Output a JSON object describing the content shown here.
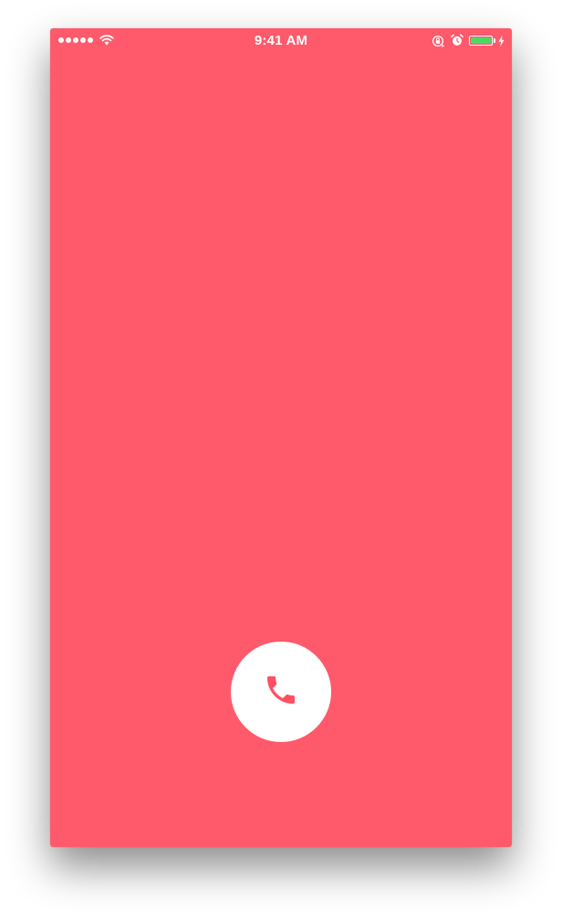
{
  "status_bar": {
    "time": "9:41 AM",
    "signal_dots": 5,
    "icons": [
      "wifi-icon",
      "orientation-lock-icon",
      "alarm-icon",
      "battery-icon",
      "charging-bolt-icon"
    ],
    "battery_level": 1.0,
    "battery_color": "#4cd964"
  },
  "screen": {
    "background_color": "#ff5a6b"
  },
  "call_button": {
    "icon": "phone-icon",
    "icon_color": "#ff4f62",
    "background_color": "#ffffff"
  }
}
